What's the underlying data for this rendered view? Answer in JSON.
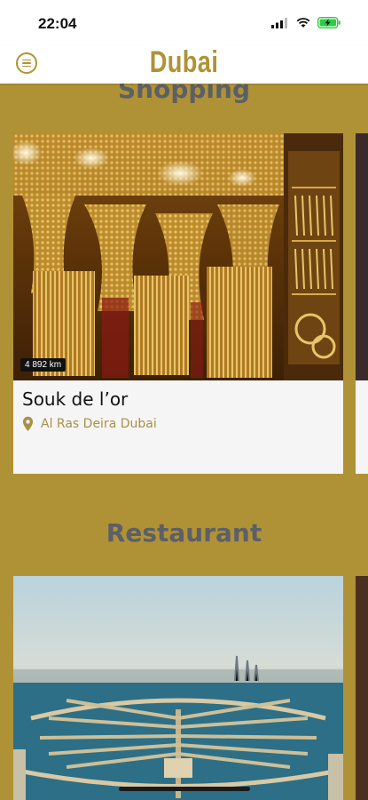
{
  "status_bar": {
    "time": "22:04"
  },
  "header": {
    "title": "Dubai",
    "menu_icon": "menu-icon"
  },
  "sections": [
    {
      "title": "Shopping",
      "cards": [
        {
          "name": "Souk de l’or",
          "location": "Al Ras Deira Dubai",
          "distance": "4 892 km"
        }
      ]
    },
    {
      "title": "Restaurant",
      "cards": [
        {
          "name": "",
          "location": "",
          "distance": ""
        }
      ]
    }
  ],
  "colors": {
    "accent": "#b09236",
    "section_title": "#5c5f66",
    "card_bg": "#f5f5f5"
  }
}
